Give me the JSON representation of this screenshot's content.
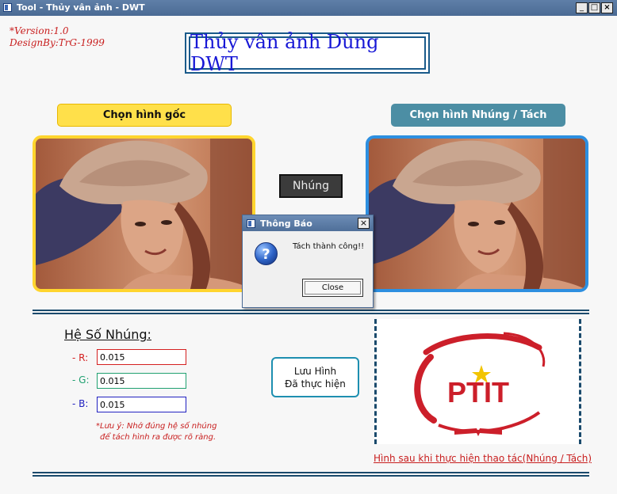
{
  "window": {
    "title": "Tool - Thủy vân ảnh  - DWT",
    "minimize_glyph": "_",
    "maximize_glyph": "□",
    "close_glyph": "×"
  },
  "header": {
    "version_line": "*Version:1.0",
    "design_line": "DesignBy:TrG-1999",
    "main_title": "Thủy vân ảnh Dùng DWT"
  },
  "buttons": {
    "choose_original": "Chọn hình gốc",
    "choose_embed_extract": "Chọn hình Nhúng / Tách",
    "embed": "Nhúng",
    "save_line1": "Lưu Hình",
    "save_line2": "Đã thực hiện"
  },
  "coefficients": {
    "title": "Hệ Số Nhúng:",
    "r_label": "- R:",
    "g_label": "- G:",
    "b_label": "- B:",
    "r_value": "0.015",
    "g_value": "0.015",
    "b_value": "0.015",
    "note_line1": "*Lưu ý: Nhớ đúng hệ số nhúng",
    "note_line2": "để tách hình ra được rõ ràng."
  },
  "result": {
    "caption": "Hình sau khi thực hiện thao tác(Nhúng / Tách)",
    "logo_text": "PTIT"
  },
  "dialog": {
    "title": "Thông Báo",
    "message": "Tách thành công!!",
    "close_label": "Close",
    "close_glyph": "×"
  },
  "colors": {
    "accent_red": "#c81e1e",
    "title_blue": "#1818d6",
    "yellow_button": "#ffe04a",
    "teal_button": "#4c8ea4",
    "frame_yellow": "#ffd52e",
    "frame_blue": "#2d8fe0",
    "r_border": "#d42020",
    "g_border": "#20a070",
    "b_border": "#2020c0"
  },
  "icons": {
    "app": "window-icon",
    "dialog_question": "question-icon"
  }
}
